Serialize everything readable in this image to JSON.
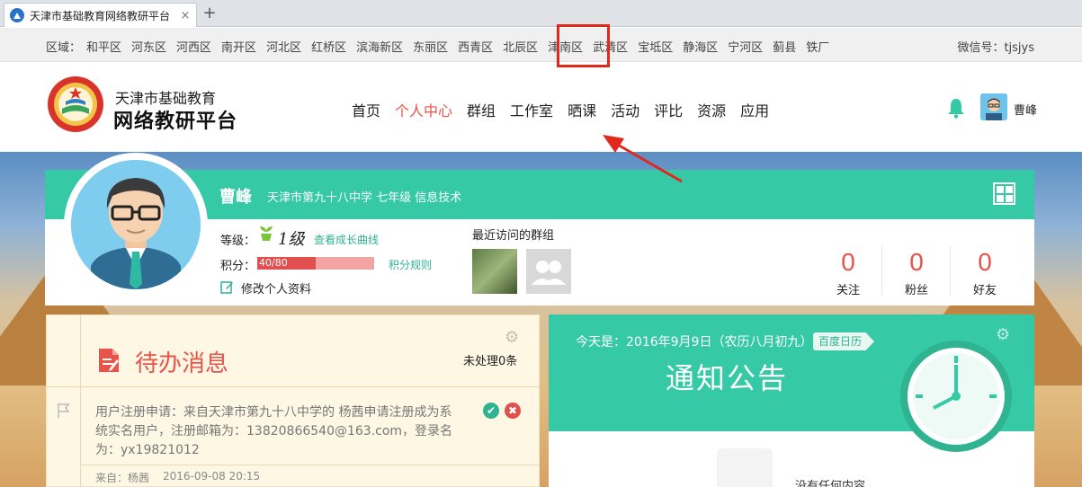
{
  "browser": {
    "tab_title": "天津市基础教育网络教研平台",
    "tab_close": "×",
    "new_tab": "+"
  },
  "district_bar": {
    "label": "区域：",
    "districts": [
      "和平区",
      "河东区",
      "河西区",
      "南开区",
      "河北区",
      "红桥区",
      "滨海新区",
      "东丽区",
      "西青区",
      "北辰区",
      "津南区",
      "武清区",
      "宝坻区",
      "静海区",
      "宁河区",
      "蓟县",
      "铁厂"
    ],
    "wechat": "微信号：tjsjys"
  },
  "header": {
    "logo_line1": "天津市基础教育",
    "logo_line2": "网络教研平台",
    "nav": [
      "首页",
      "个人中心",
      "群组",
      "工作室",
      "晒课",
      "活动",
      "评比",
      "资源",
      "应用"
    ],
    "active_nav": "个人中心",
    "highlighted_nav": "晒课",
    "user_name": "曹峰"
  },
  "profile": {
    "name": "曹峰",
    "school_info": "天津市第九十八中学  七年级 信息技术",
    "level_label": "等级：",
    "level_value": "1级",
    "growth_link": "查看成长曲线",
    "points_label": "积分：",
    "points_text": "40/80",
    "points_fraction": 0.5,
    "points_rule_link": "积分规则",
    "edit_profile": "修改个人资料",
    "recent_groups_label": "最近访问的群组",
    "stats": [
      {
        "value": "0",
        "label": "关注"
      },
      {
        "value": "0",
        "label": "粉丝"
      },
      {
        "value": "0",
        "label": "好友"
      }
    ]
  },
  "todo": {
    "title": "待办消息",
    "unprocessed": "未处理0条",
    "message": "用户注册申请：来自天津市第九十八中学的 杨茜申请注册成为系统实名用户，注册邮箱为：13820866540@163.com，登录名为：yx19821012",
    "from": "来自：杨茜",
    "time": "2016-09-08 20:15"
  },
  "notice": {
    "date": "今天是：2016年9月9日（农历八月初九）",
    "baidu_calendar": "百度日历",
    "title": "通知公告",
    "empty_text": "没有任何内容"
  },
  "colors": {
    "accent_green": "#35c9a5",
    "accent_red": "#e8534a",
    "highlight_box": "#e0281c"
  }
}
